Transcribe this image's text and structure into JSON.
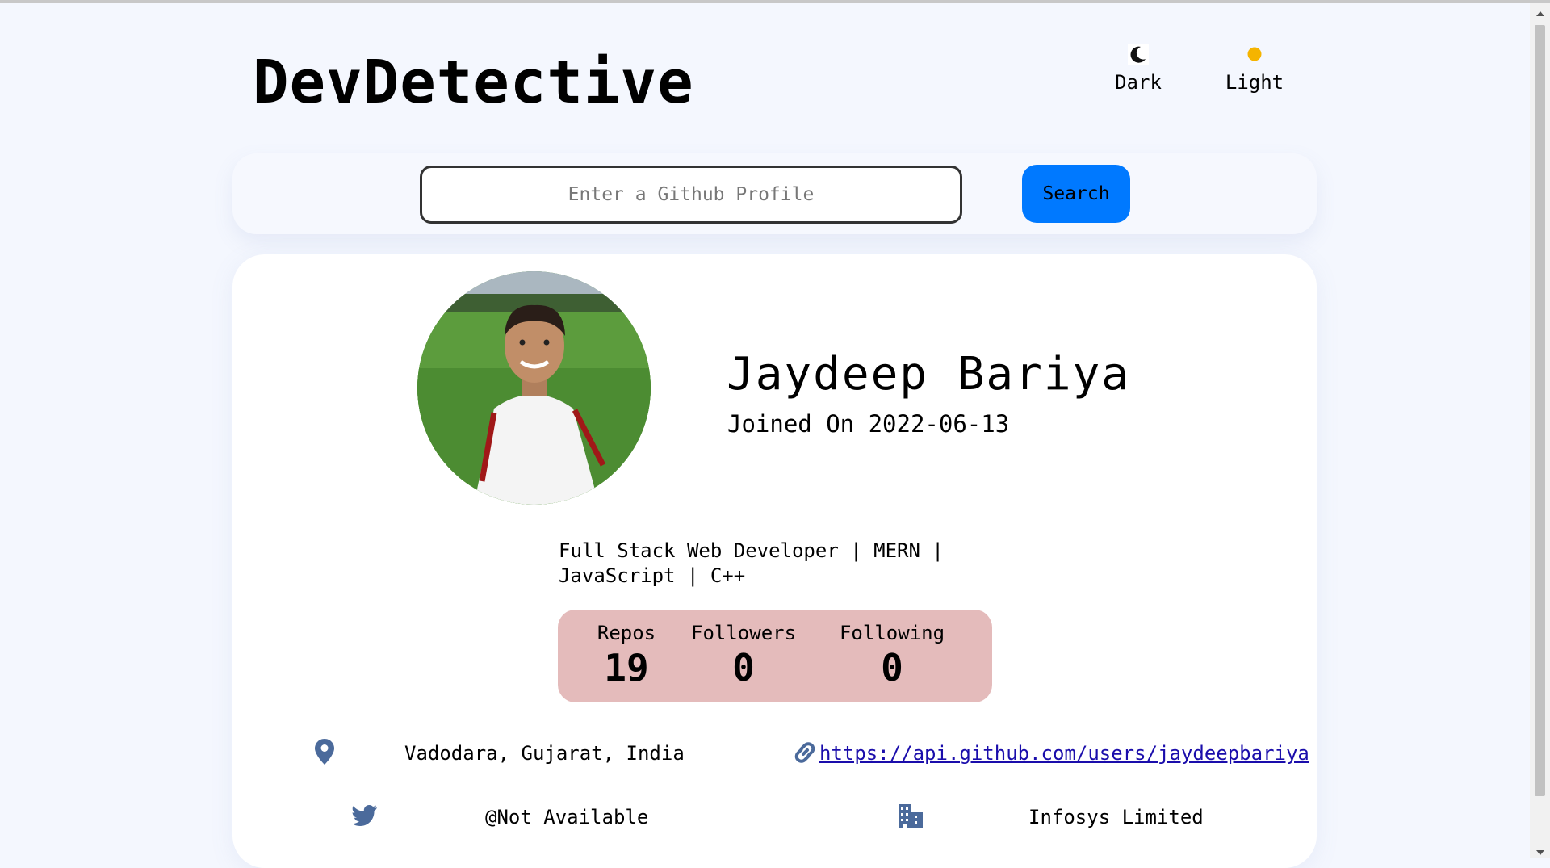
{
  "app": {
    "title": "DevDetective"
  },
  "theme_toggle": {
    "dark_label": "Dark",
    "light_label": "Light"
  },
  "search": {
    "placeholder": "Enter a Github Profile",
    "value": "",
    "button_label": "Search"
  },
  "profile": {
    "name": "Jaydeep Bariya",
    "joined": "Joined On 2022-06-13",
    "bio": "Full Stack Web Developer | MERN | JavaScript | C++",
    "stats": {
      "repos_label": "Repos",
      "repos": "19",
      "followers_label": "Followers",
      "followers": "0",
      "following_label": "Following",
      "following": "0"
    },
    "location": "Vadodara, Gujarat, India",
    "blog": "https://api.github.com/users/jaydeepbariya",
    "twitter": "@Not Available",
    "company": "Infosys Limited"
  },
  "colors": {
    "accent": "#0079ff",
    "stats_bg": "#e4bbbb",
    "icon": "#4b6a9b",
    "page_bg": "#f4f7fe",
    "sun": "#f5b400",
    "link": "#1a0dab"
  },
  "icons": [
    "moon-icon",
    "sun-icon",
    "location-pin-icon",
    "link-icon",
    "twitter-icon",
    "building-icon"
  ]
}
